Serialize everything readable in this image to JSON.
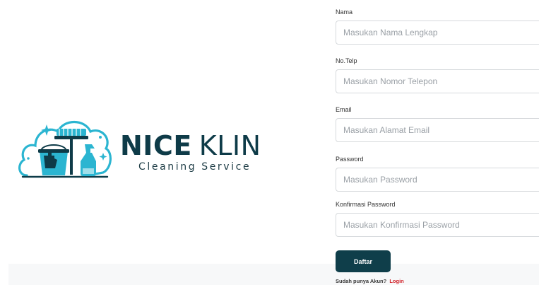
{
  "colors": {
    "accent": "#0f3e4a",
    "logo_teal": "#2bb5d1",
    "link_red": "#d2232a"
  },
  "logo": {
    "name_part1": "NICE",
    "name_part2": "KLIN",
    "tagline": "Cleaning Service",
    "icons": [
      "broom-icon",
      "bucket-icon",
      "glove-icon",
      "spray-bottle-icon",
      "sparkle-icon"
    ]
  },
  "form": {
    "fields": [
      {
        "label": "Nama",
        "placeholder": "Masukan Nama Lengkap",
        "value": ""
      },
      {
        "label": "No.Telp",
        "placeholder": "Masukan Nomor Telepon",
        "value": ""
      },
      {
        "label": "Email",
        "placeholder": "Masukan Alamat Email",
        "value": ""
      },
      {
        "label": "Password",
        "placeholder": "Masukan Password",
        "value": ""
      },
      {
        "label": "Konfirmasi Password",
        "placeholder": "Masukan Konfirmasi Password",
        "value": ""
      }
    ],
    "submit_label": "Daftar",
    "login_prompt": "Sudah punya Akun?",
    "login_link": "Login"
  }
}
